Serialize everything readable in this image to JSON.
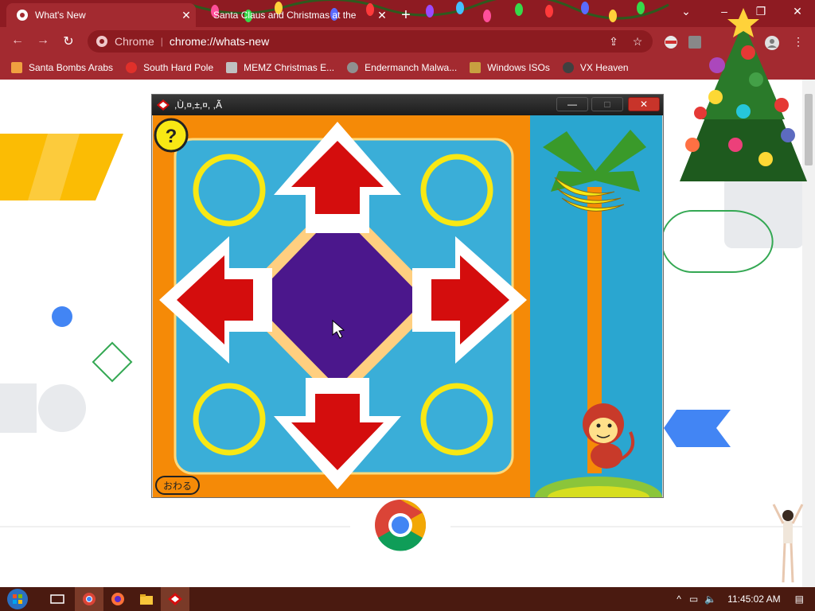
{
  "browser": {
    "tabs": [
      {
        "title": "What's New",
        "active": true
      },
      {
        "title": "Santa Claus and Christmas at the",
        "active": false
      }
    ],
    "new_tab_label": "+",
    "window_controls": {
      "tab_search": "⌄",
      "minimize": "–",
      "maximize": "❐",
      "close": "✕"
    },
    "address": {
      "site_label": "Chrome",
      "separator": "|",
      "url": "chrome://whats-new"
    },
    "bookmarks": [
      {
        "label": "Santa Bombs Arabs",
        "icon": "figure-icon",
        "color": "#f0a040"
      },
      {
        "label": "South Hard Pole",
        "icon": "star-badge-icon",
        "color": "#e0302a"
      },
      {
        "label": "MEMZ Christmas E...",
        "icon": "image-thumb-icon",
        "color": "#c0c0c0"
      },
      {
        "label": "Endermanch Malwa...",
        "icon": "cat-icon",
        "color": "#909090"
      },
      {
        "label": "Windows ISOs",
        "icon": "trophy-icon",
        "color": "#c8a040"
      },
      {
        "label": "VX Heaven",
        "icon": "skull-icon",
        "color": "#404040"
      }
    ]
  },
  "app_window": {
    "title": ",Ù,¤,±,¤, ,Ã",
    "controls": {
      "minimize": "—",
      "maximize": "□",
      "close": "✕"
    },
    "help_label": "?",
    "quit_label": "おわる",
    "colors": {
      "frame": "#f58a07",
      "board": "#3aaed8",
      "center": "#4b178c",
      "arrow": "#d40d0d",
      "ring": "#f8e814"
    }
  },
  "taskbar": {
    "apps": [
      "start-orb-icon",
      "task-view-icon",
      "chrome-icon",
      "firefox-icon",
      "file-explorer-icon",
      "game-icon"
    ],
    "tray": {
      "chevron": "^",
      "time": "11:45:02 AM"
    }
  }
}
